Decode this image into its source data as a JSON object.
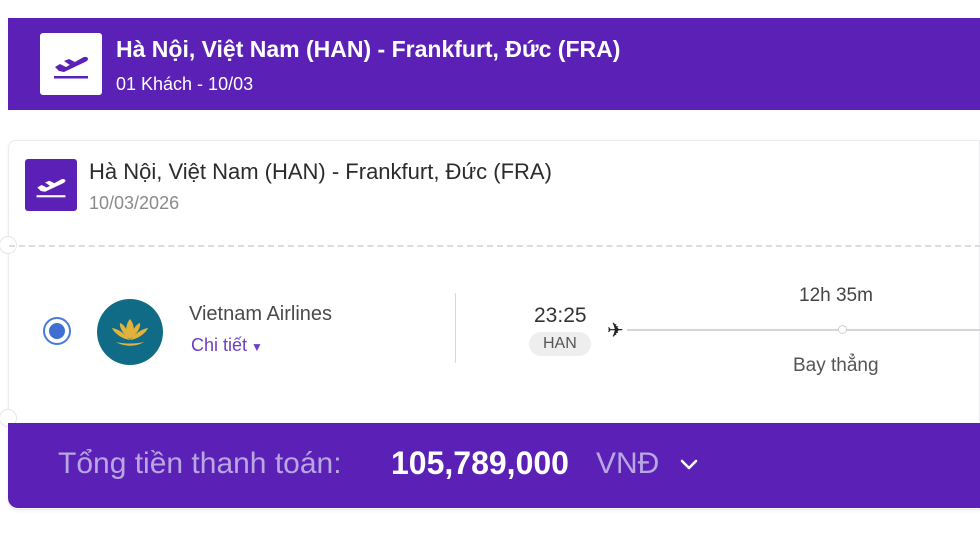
{
  "header": {
    "route": "Hà Nội, Việt Nam (HAN) - Frankfurt, Đức (FRA)",
    "summary": "01 Khách - 10/03",
    "icon": "plane-takeoff-icon"
  },
  "flight_card": {
    "route": "Hà Nội, Việt Nam (HAN) - Frankfurt, Đức (FRA)",
    "date": "10/03/2026",
    "icon": "plane-takeoff-icon",
    "option": {
      "selected": true,
      "airline": "Vietnam Airlines",
      "detail_label": "Chi tiết",
      "departure_time": "23:25",
      "departure_code": "HAN",
      "duration": "12h 35m",
      "stops": "Bay thẳng"
    }
  },
  "total": {
    "label": "Tổng tiền thanh toán:",
    "amount": "105,789,000",
    "currency": "VNĐ"
  },
  "colors": {
    "brand": "#5b21b6",
    "link": "#6d3fc6",
    "radio": "#3f6fd0",
    "airline_logo": "#0f6b86",
    "lotus": "#e3b23c"
  }
}
